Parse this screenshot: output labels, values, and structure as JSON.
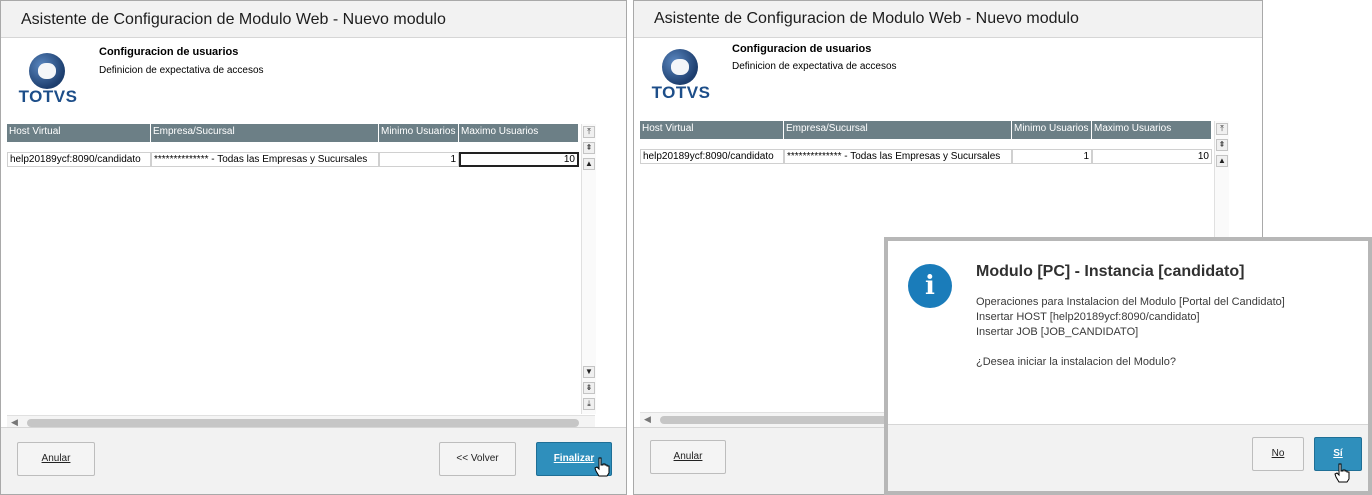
{
  "wizard_left": {
    "title": "Asistente de Configuracion de Modulo Web - Nuevo modulo",
    "logo_text": "TOTVS",
    "step_title": "Configuracion de usuarios",
    "step_subtitle": "Definicion de expectativa de accesos",
    "columns": [
      "Host Virtual",
      "Empresa/Sucursal",
      "Minimo Usuarios",
      "Maximo Usuarios"
    ],
    "rows": [
      {
        "host": "help20189ycf:8090/candidato",
        "empresa": "************** - Todas las Empresas y Sucursales",
        "min": "1",
        "max": "10"
      }
    ],
    "buttons": {
      "cancel": "Anular",
      "back": "<< Volver",
      "finish": "Finalizar"
    }
  },
  "wizard_right": {
    "title": "Asistente de Configuracion de Modulo Web - Nuevo modulo",
    "logo_text": "TOTVS",
    "step_title": "Configuracion de usuarios",
    "step_subtitle": "Definicion de expectativa de accesos",
    "columns": [
      "Host Virtual",
      "Empresa/Sucursal",
      "Minimo Usuarios",
      "Maximo Usuarios"
    ],
    "rows": [
      {
        "host": "help20189ycf:8090/candidato",
        "empresa": "************** - Todas las Empresas y Sucursales",
        "min": "1",
        "max": "10"
      }
    ],
    "buttons": {
      "cancel": "Anular"
    }
  },
  "dialog": {
    "title": "Modulo [PC] - Instancia [candidato]",
    "lines": [
      "Operaciones para Instalacion del Modulo [Portal del Candidato]",
      "Insertar HOST [help20189ycf:8090/candidato]",
      "Insertar JOB [JOB_CANDIDATO]"
    ],
    "question": "¿Desea iniciar la instalacion del Modulo?",
    "buttons": {
      "no": "No",
      "yes": "Sí"
    }
  },
  "icons": [
    "info-icon",
    "totvs-logo-icon",
    "scroll-up-icon",
    "scroll-down-icon",
    "hand-cursor-icon"
  ],
  "colors": {
    "primary_button": "#2f8fbc",
    "grid_header": "#6c7f86",
    "info_icon": "#1a7cba",
    "brand": "#1d4e89"
  }
}
